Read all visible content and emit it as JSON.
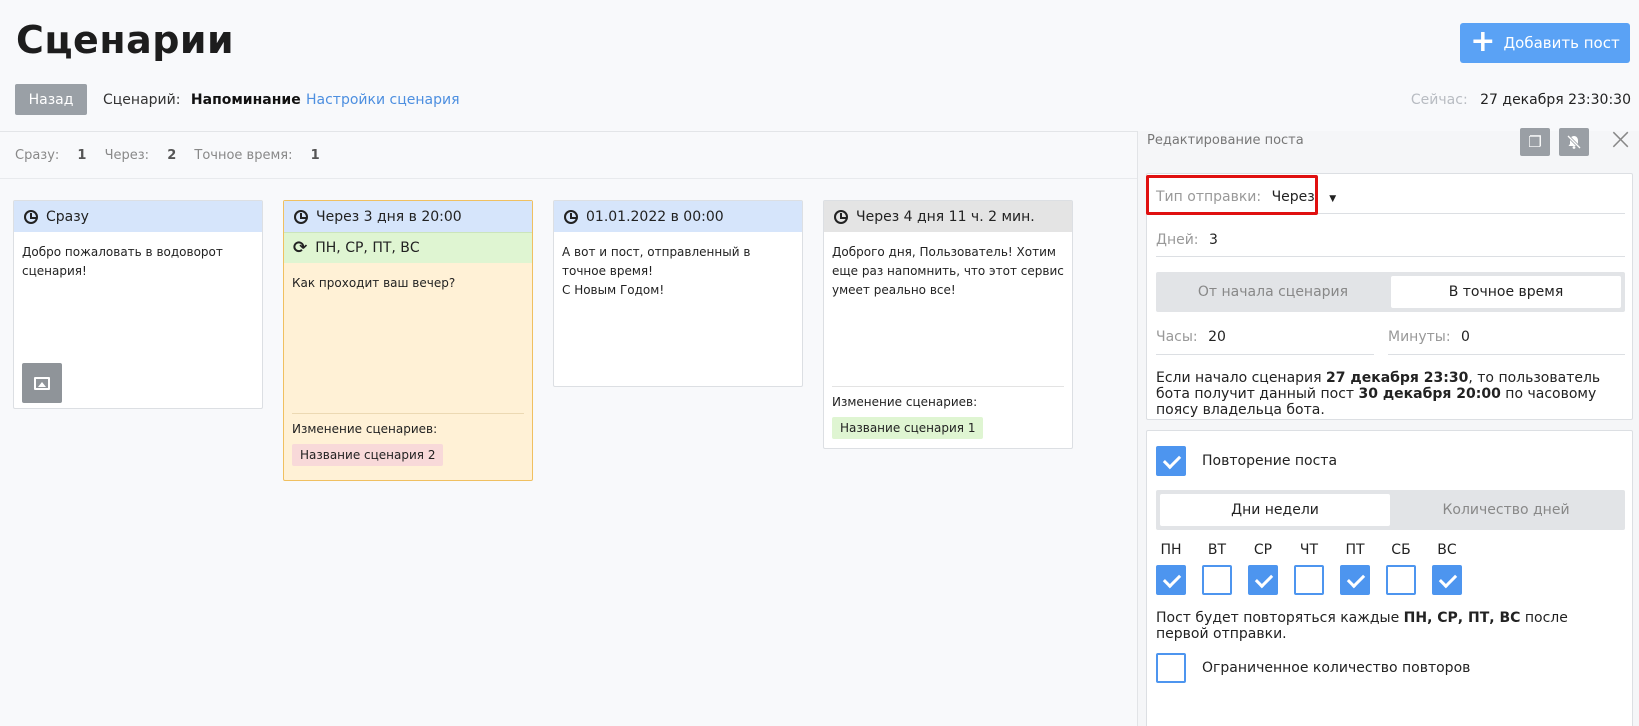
{
  "header": {
    "title": "Сценарии",
    "add_post": "Добавить пост",
    "back": "Назад",
    "scenario_label": "Сценарий:",
    "scenario_name": "Напоминание",
    "scenario_settings": "Настройки сценария",
    "now_label": "Сейчас:",
    "now_value": "27 декабря 23:30:30"
  },
  "counts": {
    "immediately_label": "Сразу:",
    "immediately_value": "1",
    "after_label": "Через:",
    "after_value": "2",
    "exact_label": "Точное время:",
    "exact_value": "1"
  },
  "cards": [
    {
      "title": "Сразу",
      "text": "Добро пожаловать в водоворот сценария!"
    },
    {
      "title": "Через 3 дня в 20:00",
      "repeat": "ПН, СР, ПТ, ВС",
      "text": "Как проходит ваш вечер?",
      "change_label": "Изменение сценариев:",
      "tag": "Название сценария 2"
    },
    {
      "title": "01.01.2022 в 00:00",
      "text_line1": "А вот и пост, отправленный в точное время!",
      "text_line2": "С Новым Годом!"
    },
    {
      "title": "Через 4 дня 11 ч. 2 мин.",
      "text": "Доброго дня, Пользователь! Хотим еще раз напомнить, что этот сервис умеет реально все!",
      "change_label": "Изменение сценариев:",
      "tag": "Название сценария 1"
    }
  ],
  "panel": {
    "title": "Редактирование поста",
    "send_type_label": "Тип отправки:",
    "send_type_value": "Через",
    "days_label": "Дней:",
    "days_value": "3",
    "mode_from_start": "От начала сценария",
    "mode_exact": "В точное время",
    "hours_label": "Часы:",
    "hours_value": "20",
    "minutes_label": "Минуты:",
    "minutes_value": "0",
    "info_a": "Если начало сценария ",
    "info_b": "27 декабря 23:30",
    "info_c": ", то пользователь бота получит данный пост ",
    "info_d": "30 декабря 20:00",
    "info_e": " по часовому поясу владельца бота.",
    "repeat_label": "Повторение поста",
    "tab_weekdays": "Дни недели",
    "tab_count": "Количество дней",
    "days": [
      {
        "name": "ПН",
        "checked": true
      },
      {
        "name": "ВТ",
        "checked": false
      },
      {
        "name": "СР",
        "checked": true
      },
      {
        "name": "ЧТ",
        "checked": false
      },
      {
        "name": "ПТ",
        "checked": true
      },
      {
        "name": "СБ",
        "checked": false
      },
      {
        "name": "ВС",
        "checked": true
      }
    ],
    "repeat_note_a": "Пост будет повторяться каждые ",
    "repeat_note_b": "ПН, СР, ПТ, ВС",
    "repeat_note_c": " после первой отправки.",
    "limited_label": "Ограниченное количество повторов"
  },
  "colors": {
    "accent": "#5aa2f5",
    "checkbox": "#4d95ef",
    "card_head": "#d6e5fb",
    "repeat_bg": "#dff5d2",
    "highlight_card": "#fff1d6",
    "red_outline": "#e01010"
  }
}
